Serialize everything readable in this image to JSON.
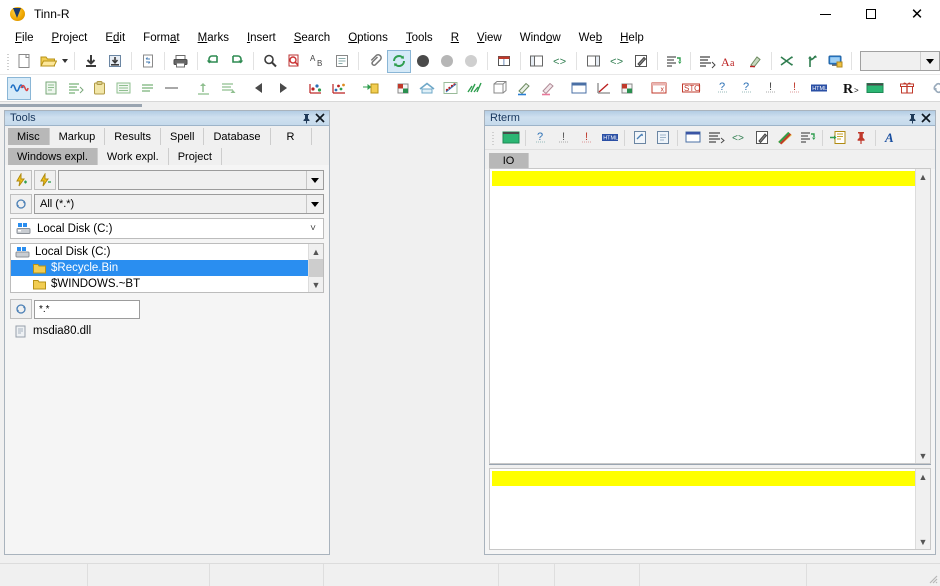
{
  "window": {
    "title": "Tinn-R",
    "app_icon": "tinn-r-logo-icon",
    "minimize_label": "—",
    "maximize_label": "□",
    "close_label": "✕"
  },
  "menubar": {
    "items": [
      {
        "label": "File",
        "accel": "F"
      },
      {
        "label": "Project",
        "accel": "P"
      },
      {
        "label": "Edit",
        "accel": "d"
      },
      {
        "label": "Format",
        "accel": "a"
      },
      {
        "label": "Marks",
        "accel": "M"
      },
      {
        "label": "Insert",
        "accel": "I"
      },
      {
        "label": "Search",
        "accel": "S"
      },
      {
        "label": "Options",
        "accel": "O"
      },
      {
        "label": "Tools",
        "accel": "T"
      },
      {
        "label": "R",
        "accel": "R"
      },
      {
        "label": "View",
        "accel": "V"
      },
      {
        "label": "Window",
        "accel": "o"
      },
      {
        "label": "Web",
        "accel": "b"
      },
      {
        "label": "Help",
        "accel": "H"
      }
    ]
  },
  "toolbar_main": {
    "combo_value": "",
    "buttons": [
      {
        "name": "new-file-icon",
        "title": "New"
      },
      {
        "name": "open-file-icon",
        "title": "Open"
      },
      {
        "name": "open-dropdown-caret-icon",
        "title": "Open recent"
      },
      {
        "name": "save-file-icon",
        "title": "Save"
      },
      {
        "name": "save-all-icon",
        "title": "Save all"
      },
      {
        "name": "reload-file-icon",
        "title": "Reload"
      },
      {
        "name": "print-icon",
        "title": "Print"
      },
      {
        "name": "undo-icon",
        "title": "Undo"
      },
      {
        "name": "redo-icon",
        "title": "Redo"
      },
      {
        "name": "search-icon",
        "title": "Find"
      },
      {
        "name": "find-replace-icon",
        "title": "Replace"
      },
      {
        "name": "change-case-icon",
        "title": "Change case"
      },
      {
        "name": "word-wrap-icon",
        "title": "Wrap"
      },
      {
        "name": "attach-clip-icon",
        "title": "Attach"
      },
      {
        "name": "refresh-green-icon",
        "title": "Refresh"
      },
      {
        "name": "bullet-dark-icon",
        "title": "Marker 1"
      },
      {
        "name": "bullet-gray-icon",
        "title": "Marker 2"
      },
      {
        "name": "bullet-light-icon",
        "title": "Marker 3"
      },
      {
        "name": "layout-panels-icon",
        "title": "Panels"
      },
      {
        "name": "split-left-icon",
        "title": "Split left"
      },
      {
        "name": "code-brackets-left-icon",
        "title": "Code left"
      },
      {
        "name": "split-right-icon",
        "title": "Split right"
      },
      {
        "name": "code-brackets-right-icon",
        "title": "Code right"
      },
      {
        "name": "pencil-edit-icon",
        "title": "Edit"
      },
      {
        "name": "indent-green-icon",
        "title": "Indent"
      },
      {
        "name": "list-lines-icon",
        "title": "Lines"
      },
      {
        "name": "font-aa-icon",
        "title": "Font"
      },
      {
        "name": "highlight-pen-icon",
        "title": "Highlight"
      },
      {
        "name": "shuffle-icon",
        "title": "Shuffle"
      },
      {
        "name": "branch-icon",
        "title": "Branch"
      },
      {
        "name": "monitor-icon",
        "title": "Monitor"
      }
    ]
  },
  "toolbar_r": {
    "buttons": [
      {
        "name": "r-wave-icon",
        "title": "R"
      },
      {
        "name": "document-green-icon",
        "title": "Script"
      },
      {
        "name": "document-lines-icon",
        "title": "Lines"
      },
      {
        "name": "clipboard-icon",
        "title": "Clipboard"
      },
      {
        "name": "list-block-icon",
        "title": "Block"
      },
      {
        "name": "list-rows-icon",
        "title": "Rows"
      },
      {
        "name": "minus-line-icon",
        "title": "Line"
      },
      {
        "name": "send-up-icon",
        "title": "Send up"
      },
      {
        "name": "send-down-icon",
        "title": "Send down"
      },
      {
        "name": "prev-arrow-icon",
        "title": "Previous"
      },
      {
        "name": "next-arrow-icon",
        "title": "Next"
      },
      {
        "name": "plot-points-icon",
        "title": "Plot"
      },
      {
        "name": "plot-multi-icon",
        "title": "Plot multi"
      },
      {
        "name": "package-out-icon",
        "title": "Package"
      },
      {
        "name": "package-in-icon",
        "title": "Package in"
      },
      {
        "name": "cube-data-icon",
        "title": "Data"
      },
      {
        "name": "home-icon",
        "title": "Home"
      },
      {
        "name": "scatter-plot-icon",
        "title": "Scatter"
      },
      {
        "name": "bar-lines-icon",
        "title": "Lines plot"
      },
      {
        "name": "cube-outline-icon",
        "title": "Cube"
      },
      {
        "name": "pen-blue-icon",
        "title": "Pen blue"
      },
      {
        "name": "pen-pink-icon",
        "title": "Pen pink"
      },
      {
        "name": "window-blank-icon",
        "title": "Window"
      },
      {
        "name": "axes-icon",
        "title": "Axes"
      },
      {
        "name": "package-color-icon",
        "title": "Package color"
      },
      {
        "name": "close-window-x-icon",
        "title": "Close"
      },
      {
        "name": "stop-icon",
        "title": "STOP"
      },
      {
        "name": "help-question-icon",
        "title": "Help"
      },
      {
        "name": "help-question-2-icon",
        "title": "Help 2"
      },
      {
        "name": "info-blue-icon",
        "title": "Info"
      },
      {
        "name": "info-red-icon",
        "title": "Warning"
      },
      {
        "name": "html-icon",
        "title": "HTML"
      },
      {
        "name": "r-letter-icon",
        "title": "R console"
      },
      {
        "name": "terminal-green-icon",
        "title": "Terminal"
      },
      {
        "name": "gift-icon",
        "title": "Gift"
      },
      {
        "name": "link-icon",
        "title": "Link"
      }
    ]
  },
  "tools_panel": {
    "caption": "Tools",
    "pin_icon": "pin-icon",
    "close_icon": "close-icon",
    "tabs": [
      {
        "label": "Misc",
        "selected": true
      },
      {
        "label": "Markup",
        "selected": false
      },
      {
        "label": "Results",
        "selected": false
      },
      {
        "label": "Spell",
        "selected": false
      },
      {
        "label": "Database",
        "selected": false
      },
      {
        "label": "R",
        "selected": false
      }
    ],
    "subtabs": [
      {
        "label": "Windows expl.",
        "selected": true
      },
      {
        "label": "Work expl.",
        "selected": false
      },
      {
        "label": "Project",
        "selected": false
      }
    ],
    "path_combo_value": "",
    "filter_combo_value": "All (*.*)",
    "drive_value": "Local Disk (C:)",
    "tree_items": [
      {
        "label": "Local Disk (C:)",
        "type": "drive",
        "indent": 0,
        "selected": false
      },
      {
        "label": "$Recycle.Bin",
        "type": "folder",
        "indent": 1,
        "selected": true
      },
      {
        "label": "$WINDOWS.~BT",
        "type": "folder",
        "indent": 1,
        "selected": false
      }
    ],
    "file_filter_value": "*.*",
    "files": [
      {
        "label": "msdia80.dll",
        "type": "file"
      }
    ],
    "add_bookmark_icon": "lightning-add-icon",
    "remove_bookmark_icon": "lightning-remove-icon",
    "refresh_icon": "refresh-icon",
    "file_refresh_icon": "refresh-icon"
  },
  "editor_panel": {
    "name": "editor-area",
    "content": ""
  },
  "rterm_panel": {
    "caption": "Rterm",
    "pin_icon": "pin-icon",
    "close_icon": "close-icon",
    "toolbar": [
      {
        "name": "terminal-green-icon",
        "title": "Terminal"
      },
      {
        "name": "help-question-icon",
        "title": "Help"
      },
      {
        "name": "info-gray-icon",
        "title": "Info"
      },
      {
        "name": "info-red-icon",
        "title": "Warning"
      },
      {
        "name": "html-icon",
        "title": "HTML"
      },
      {
        "name": "export-doc-icon",
        "title": "Export"
      },
      {
        "name": "document-icon",
        "title": "Document"
      },
      {
        "name": "window-blank-icon",
        "title": "Window"
      },
      {
        "name": "align-lines-icon",
        "title": "Align"
      },
      {
        "name": "code-brackets-icon",
        "title": "Code"
      },
      {
        "name": "pencil-edit-icon",
        "title": "Edit"
      },
      {
        "name": "rainbow-icon",
        "title": "Colors"
      },
      {
        "name": "indent-green-icon",
        "title": "Indent"
      },
      {
        "name": "list-import-icon",
        "title": "Import list"
      },
      {
        "name": "pin-red-icon",
        "title": "Pin"
      },
      {
        "name": "font-a-icon",
        "title": "Font"
      }
    ],
    "io_tabs": [
      {
        "label": "IO",
        "selected": true
      }
    ],
    "console_top_lines": [
      ""
    ],
    "console_bottom_lines": [
      ""
    ],
    "highlight_color": "#ffff00"
  },
  "statusbar": {
    "cells": [
      "",
      "",
      "",
      "",
      "",
      "",
      "",
      ""
    ]
  },
  "theme": {
    "caption_blue": "#b3cde4",
    "caption_text": "#17365d",
    "selection_blue": "#2a8ef0",
    "tab_selected": "#b8b8b8",
    "highlight_yellow": "#ffff00",
    "window_bg": "#f0f0f0"
  }
}
